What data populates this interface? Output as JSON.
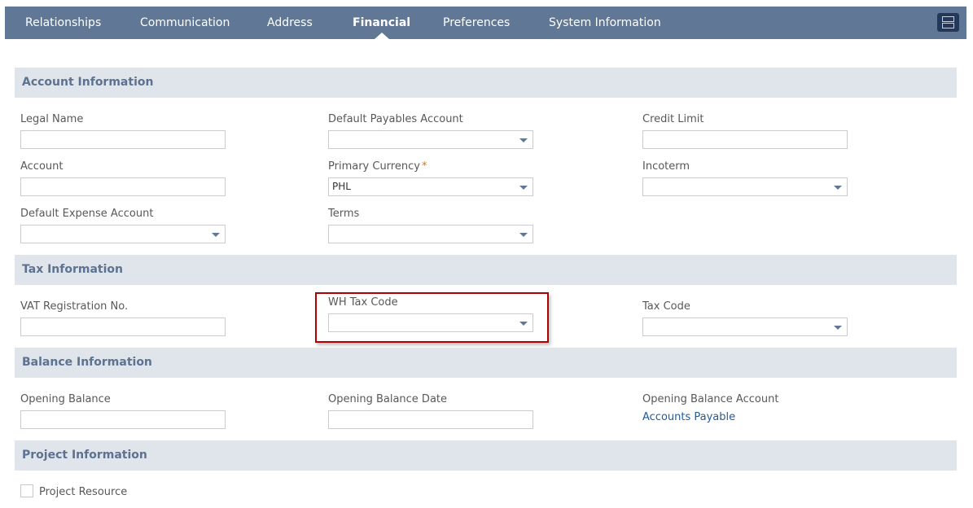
{
  "tabs": [
    {
      "label": "Relationships",
      "active": false
    },
    {
      "label": "Communication",
      "active": false
    },
    {
      "label": "Address",
      "active": false
    },
    {
      "label": "Financial",
      "active": true
    },
    {
      "label": "Preferences",
      "active": false
    },
    {
      "label": "System Information",
      "active": false
    }
  ],
  "layout_toggle_icon": "stacked-layout-icon",
  "sections": {
    "account": {
      "title": "Account Information",
      "fields": {
        "legal_name": {
          "label": "Legal Name",
          "value": ""
        },
        "default_payables_account": {
          "label": "Default Payables Account",
          "value": ""
        },
        "credit_limit": {
          "label": "Credit Limit",
          "value": ""
        },
        "account": {
          "label": "Account",
          "value": ""
        },
        "primary_currency": {
          "label": "Primary Currency",
          "required_mark": "*",
          "value": "PHL"
        },
        "incoterm": {
          "label": "Incoterm",
          "value": ""
        },
        "default_expense_account": {
          "label": "Default Expense Account",
          "value": ""
        },
        "terms": {
          "label": "Terms",
          "value": ""
        }
      }
    },
    "tax": {
      "title": "Tax Information",
      "fields": {
        "vat_registration_no": {
          "label": "VAT Registration No.",
          "value": ""
        },
        "wh_tax_code": {
          "label": "WH Tax Code",
          "value": ""
        },
        "tax_code": {
          "label": "Tax Code",
          "value": ""
        }
      }
    },
    "balance": {
      "title": "Balance Information",
      "fields": {
        "opening_balance": {
          "label": "Opening Balance",
          "value": ""
        },
        "opening_balance_date": {
          "label": "Opening Balance Date",
          "value": ""
        },
        "opening_balance_account": {
          "label": "Opening Balance Account",
          "value": "Accounts Payable"
        }
      }
    },
    "project": {
      "title": "Project Information",
      "fields": {
        "project_resource": {
          "label": "Project Resource",
          "checked": false
        }
      }
    }
  },
  "colors": {
    "tab_bar": "#607896",
    "section_header_bg": "#e0e4eb",
    "section_header_text": "#5d7290",
    "required": "#d08000",
    "link": "#245b9a",
    "highlight_border": "#b00000"
  }
}
